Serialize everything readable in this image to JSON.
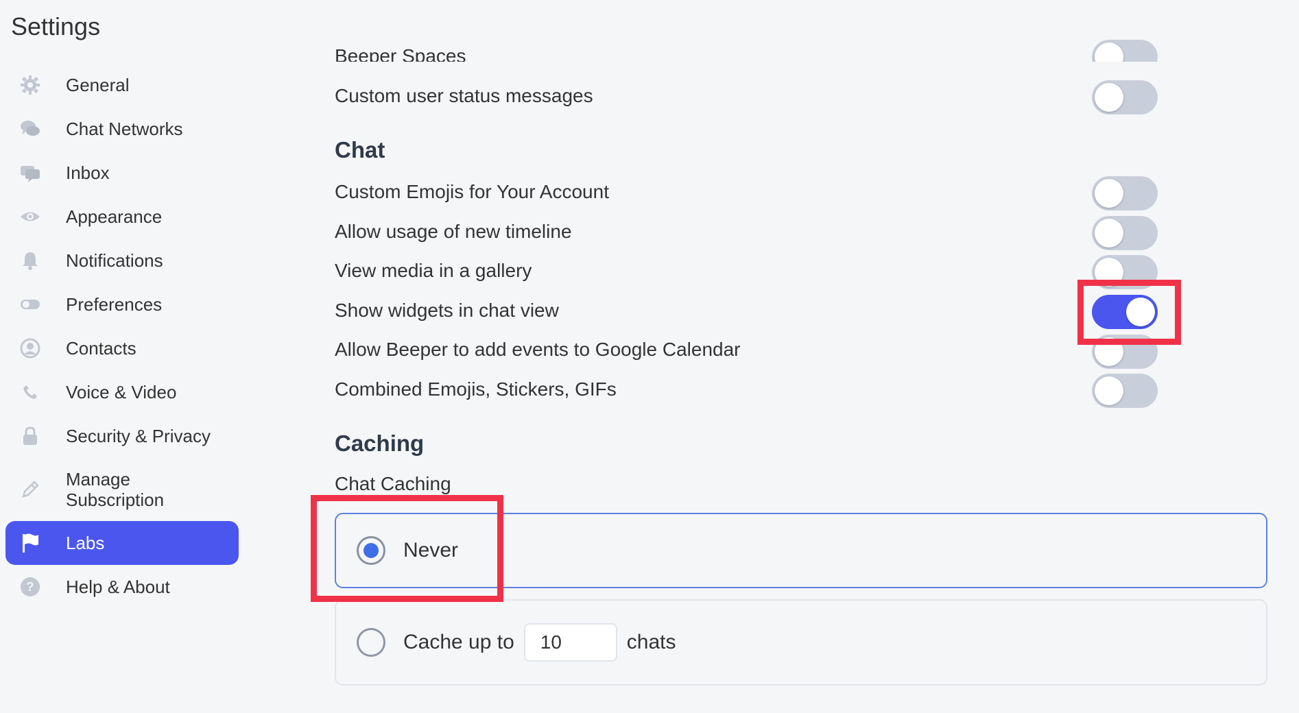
{
  "header": {
    "title": "Settings"
  },
  "sidebar": {
    "items": [
      {
        "label": "General",
        "icon": "gear-icon"
      },
      {
        "label": "Chat Networks",
        "icon": "chat-bubbles-icon"
      },
      {
        "label": "Inbox",
        "icon": "inbox-icon"
      },
      {
        "label": "Appearance",
        "icon": "eye-icon"
      },
      {
        "label": "Notifications",
        "icon": "bell-icon"
      },
      {
        "label": "Preferences",
        "icon": "toggle-icon"
      },
      {
        "label": "Contacts",
        "icon": "person-circle-icon"
      },
      {
        "label": "Voice & Video",
        "icon": "phone-icon"
      },
      {
        "label": "Security & Privacy",
        "icon": "lock-icon"
      },
      {
        "label": "Manage Subscription",
        "icon": "pencil-icon"
      },
      {
        "label": "Labs",
        "icon": "flag-icon",
        "active": true
      },
      {
        "label": "Help & About",
        "icon": "question-circle-icon"
      }
    ],
    "active_color": "#4a56ee"
  },
  "main": {
    "partial_row": {
      "label": "Beeper Spaces",
      "enabled": false
    },
    "status_row": {
      "label": "Custom user status messages",
      "enabled": false
    },
    "chat_section": {
      "title": "Chat",
      "rows": [
        {
          "label": "Custom Emojis for Your Account",
          "enabled": false
        },
        {
          "label": "Allow usage of new timeline",
          "enabled": false
        },
        {
          "label": "View media in a gallery",
          "enabled": false
        },
        {
          "label": "Show widgets in chat view",
          "enabled": true
        },
        {
          "label": "Allow Beeper to add events to Google Calendar",
          "enabled": false
        },
        {
          "label": "Combined Emojis, Stickers, GIFs",
          "enabled": false
        }
      ]
    },
    "caching_section": {
      "title": "Caching",
      "subtitle": "Chat Caching",
      "options": [
        {
          "label": "Never",
          "selected": true
        },
        {
          "label_before": "Cache up to",
          "value": "10",
          "label_after": "chats",
          "selected": false
        }
      ]
    }
  },
  "colors": {
    "accent": "#4a56ee",
    "highlight": "#f03248",
    "toggle_off": "#c9cfda",
    "radio_fill": "#3f6fe6"
  }
}
